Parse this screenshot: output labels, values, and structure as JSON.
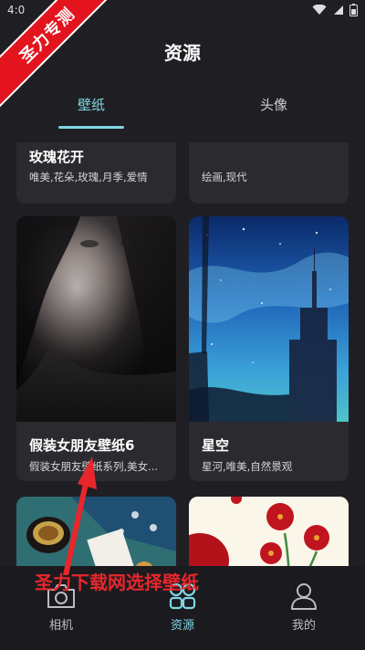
{
  "status_bar": {
    "time": "4:0"
  },
  "watermark": {
    "ribbon_text": "圣力专测"
  },
  "header": {
    "title": "资源"
  },
  "tabs": [
    {
      "label": "壁纸",
      "active": true
    },
    {
      "label": "头像",
      "active": false
    }
  ],
  "cards": [
    {
      "title": "玫瑰花开",
      "tags": "唯美,花朵,玫瑰,月季,爱情"
    },
    {
      "title": "",
      "tags": "绘画,现代"
    },
    {
      "title": "假装女朋友壁纸6",
      "tags": "假装女朋友壁纸系列,美女..."
    },
    {
      "title": "星空",
      "tags": "星河,唯美,自然景观"
    }
  ],
  "overlay": {
    "caption": "圣力下载网选择壁纸"
  },
  "bottom_nav": [
    {
      "label": "相机",
      "icon": "camera-icon",
      "active": false
    },
    {
      "label": "资源",
      "icon": "grid-icon",
      "active": true
    },
    {
      "label": "我的",
      "icon": "person-icon",
      "active": false
    }
  ],
  "colors": {
    "accent": "#7fd7e4",
    "background": "#1f1f23",
    "card": "#2a2a2f",
    "watermark_red": "#e3141e"
  }
}
